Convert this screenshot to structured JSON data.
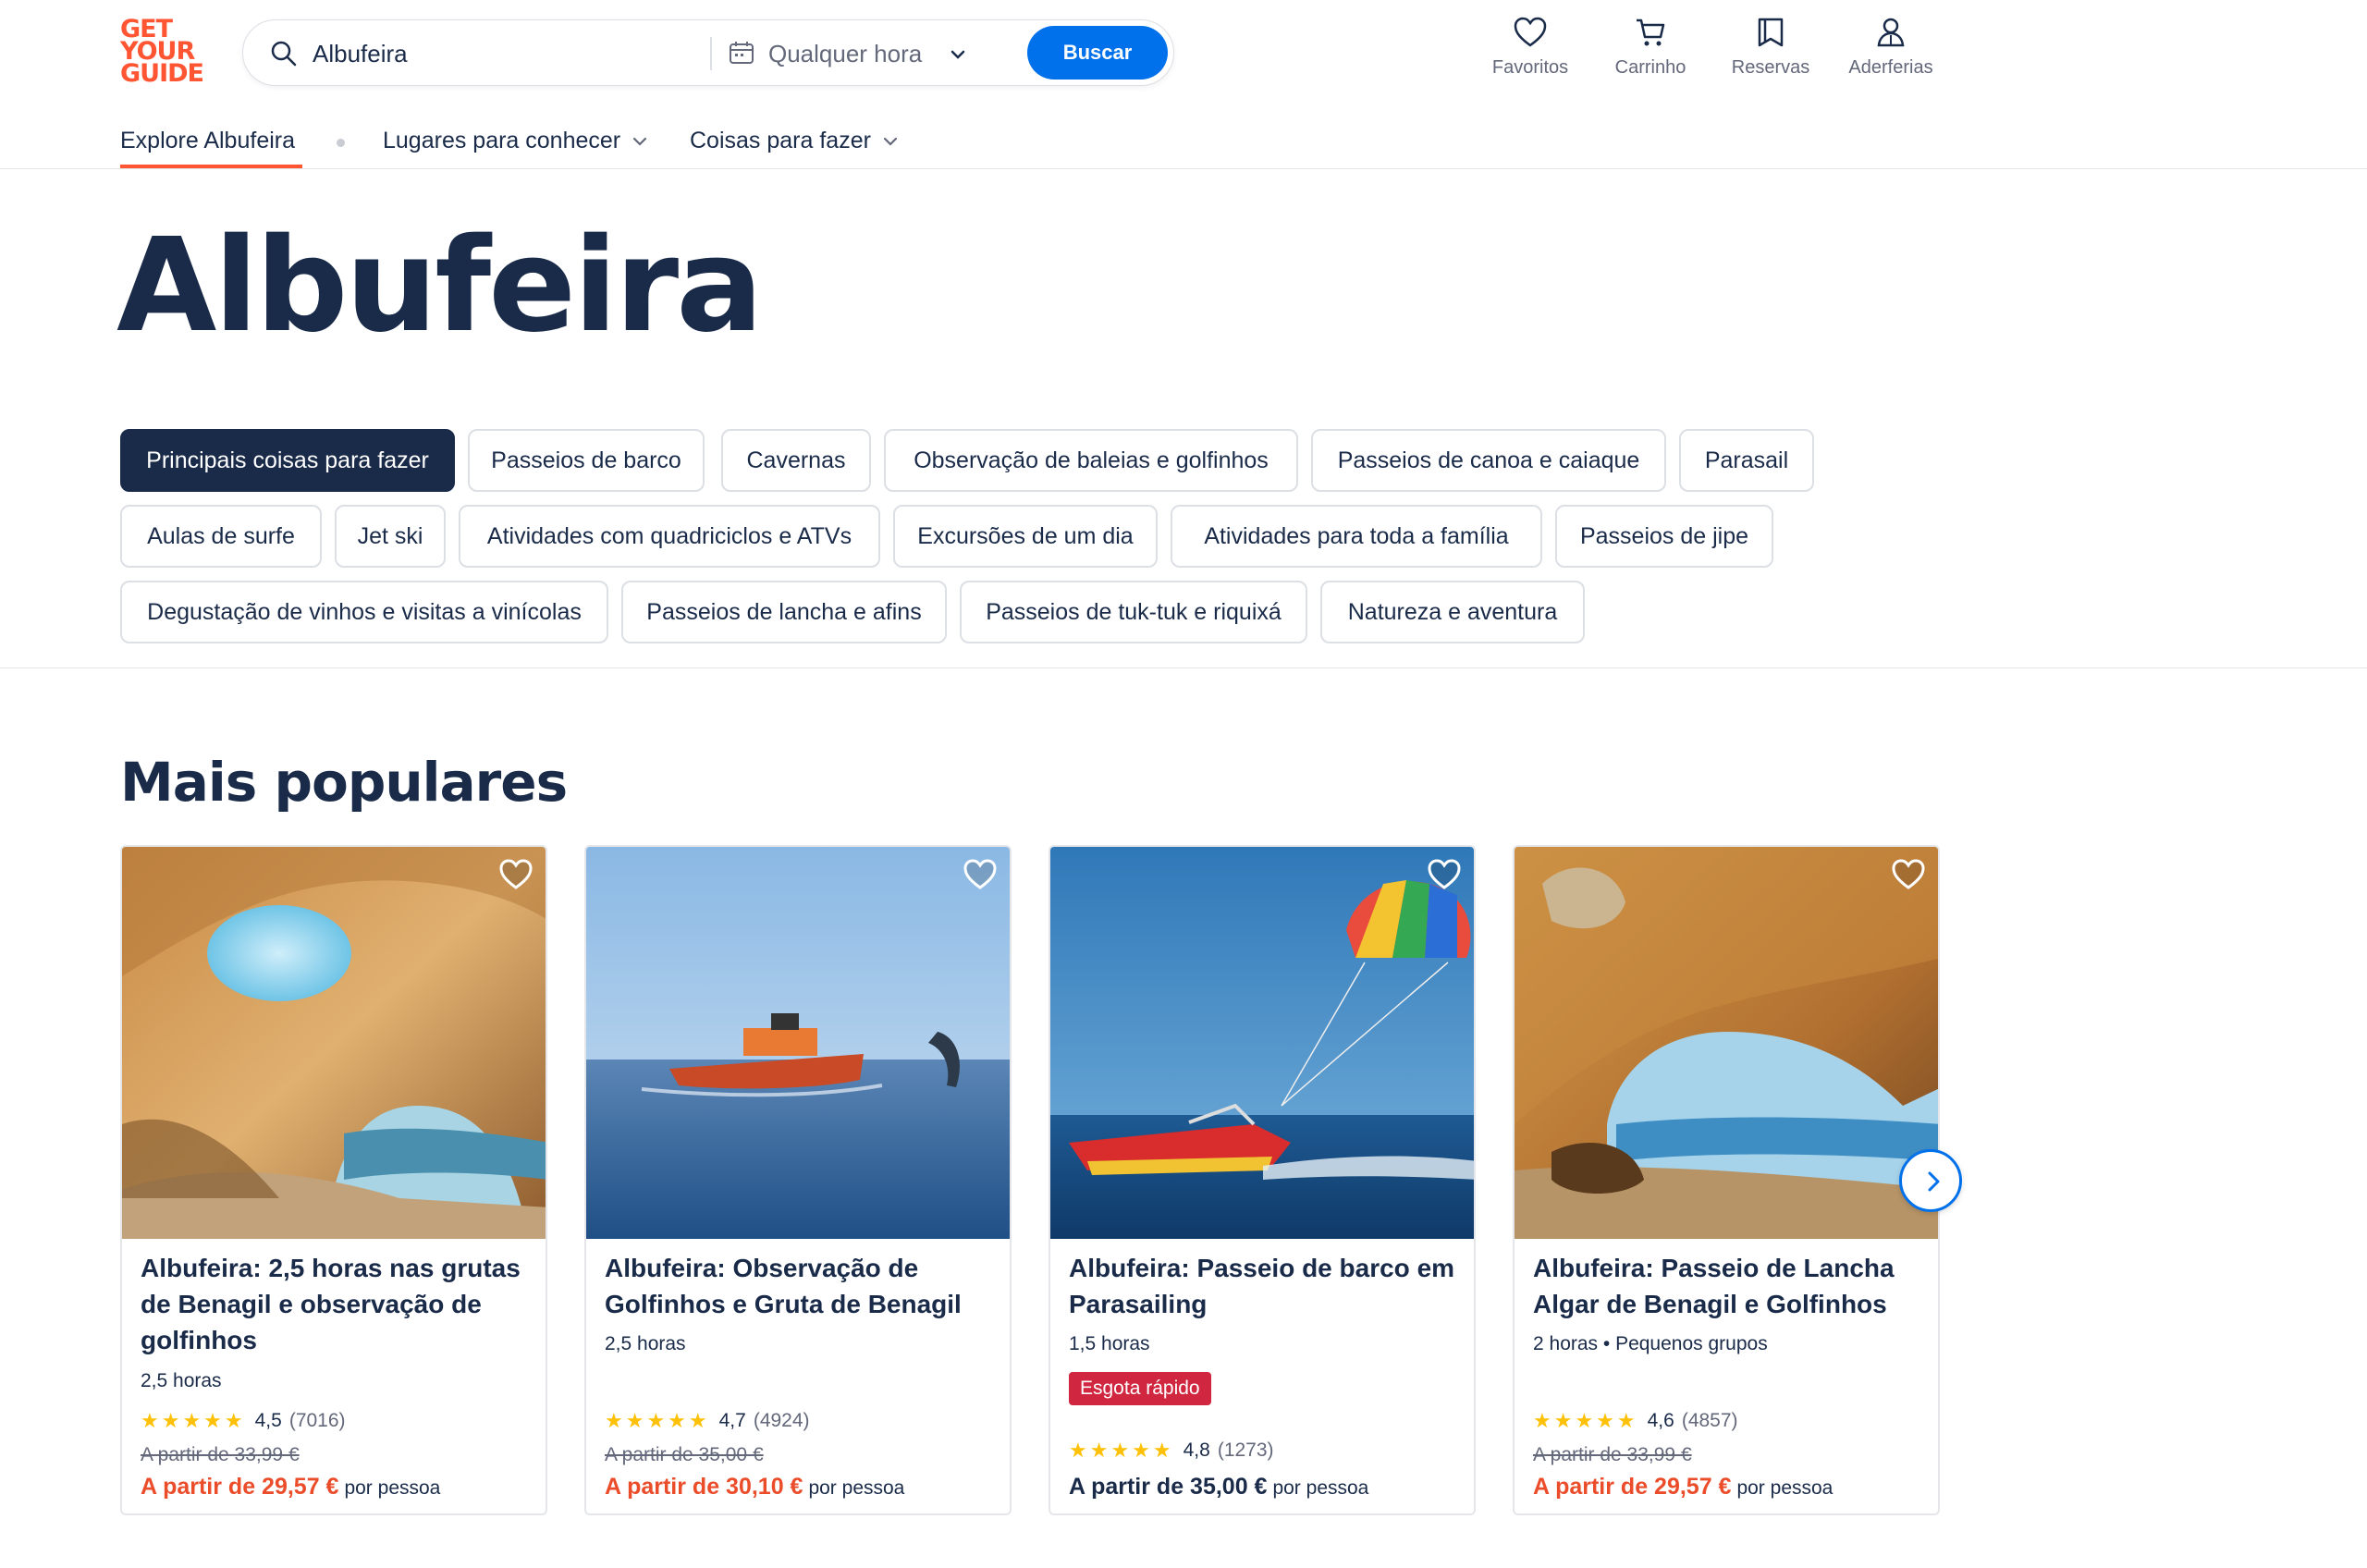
{
  "logo": {
    "line1": "GET",
    "line2": "YOUR",
    "line3": "GUIDE"
  },
  "search": {
    "query": "Albufeira",
    "when": "Qualquer hora",
    "button": "Buscar"
  },
  "nav": [
    {
      "label": "Favoritos",
      "icon": "heart-icon"
    },
    {
      "label": "Carrinho",
      "icon": "cart-icon"
    },
    {
      "label": "Reservas",
      "icon": "bookmark-icon"
    },
    {
      "label": "Aderferias",
      "icon": "user-icon"
    }
  ],
  "subnav": {
    "explore": "Explore Albufeira",
    "places": "Lugares para conhecer",
    "things": "Coisas para fazer"
  },
  "page_title": "Albufeira",
  "chips": [
    "Principais coisas para fazer",
    "Passeios de barco",
    "Cavernas",
    "Observação de baleias e golfinhos",
    "Passeios de canoa e caiaque",
    "Parasail",
    "Aulas de surfe",
    "Jet ski",
    "Atividades com quadriciclos e ATVs",
    "Excursões de um dia",
    "Atividades para toda a família",
    "Passeios de jipe",
    "Degustação de vinhos e visitas a vinícolas",
    "Passeios de lancha e afins",
    "Passeios de tuk-tuk e riquixá",
    "Natureza e aventura"
  ],
  "section_title": "Mais populares",
  "cards": [
    {
      "title": "Albufeira: 2,5 horas nas grutas de Benagil e observação de golfinhos",
      "meta": "2,5 horas",
      "rating": "4,5",
      "count": "(7016)",
      "old_price": "A partir de 33,99 €",
      "price": "A partir de 29,57 €",
      "per": "por pessoa"
    },
    {
      "title": "Albufeira: Observação de Golfinhos e Gruta de Benagil",
      "meta": "2,5 horas",
      "rating": "4,7",
      "count": "(4924)",
      "old_price": "A partir de 35,00 €",
      "price": "A partir de 30,10 €",
      "per": "por pessoa"
    },
    {
      "title": "Albufeira: Passeio de barco em Parasailing",
      "meta": "1,5 horas",
      "badge": "Esgota rápido",
      "rating": "4,8",
      "count": "(1273)",
      "price": "A partir de 35,00 €",
      "per": "por pessoa"
    },
    {
      "title": "Albufeira: Passeio de Lancha Algar de Benagil e Golfinhos",
      "meta": "2 horas • Pequenos grupos",
      "rating": "4,6",
      "count": "(4857)",
      "old_price": "A partir de 33,99 €",
      "price": "A partir de 29,57 €",
      "per": "por pessoa"
    }
  ],
  "colors": {
    "brand": "#ff5533",
    "primary": "#0071eb",
    "navy": "#1a2b49",
    "price": "#eb4c2a",
    "badge": "#d0263f"
  }
}
